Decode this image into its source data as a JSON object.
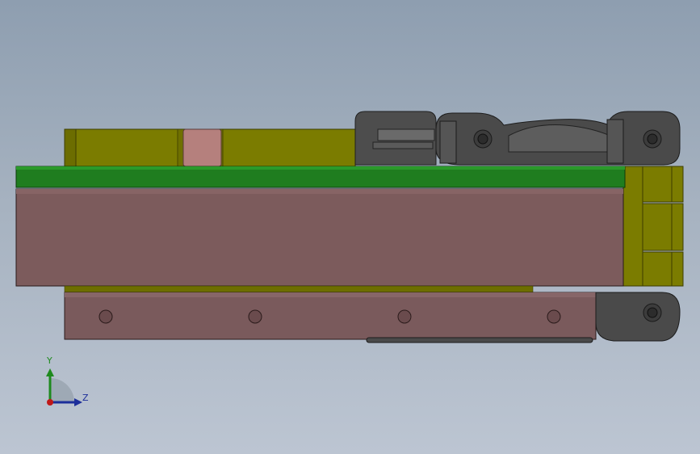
{
  "viewport": {
    "background_top": "#8e9eb0",
    "background_bottom": "#bcc5d2"
  },
  "model": {
    "colors": {
      "frame_olive": "#7a7a00",
      "pin_pink": "#b07a78",
      "pcb_green": "#1f7a1f",
      "body_mauve": "#7d5d5e",
      "rail_mauve": "#7a5a5c",
      "chain_gray": "#4a4a4a"
    }
  },
  "triad": {
    "y_label": "Y",
    "z_label": "Z",
    "y_color": "#1e8a1e",
    "z_color": "#1c2e9a",
    "origin_color": "#c01818"
  }
}
